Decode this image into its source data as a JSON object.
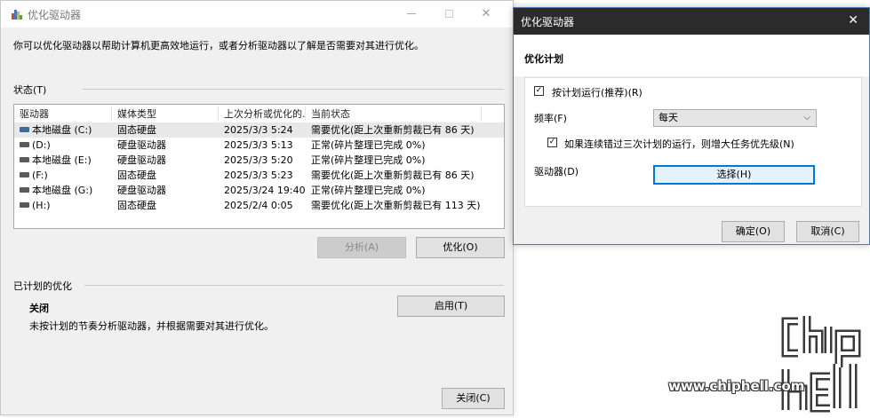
{
  "main_window": {
    "title": "优化驱动器",
    "description": "你可以优化驱动器以帮助计算机更高效地运行，或者分析驱动器以了解是否需要对其进行优化。",
    "status_label": "状态(T)",
    "columns": [
      "驱动器",
      "媒体类型",
      "上次分析或优化的...",
      "当前状态"
    ],
    "drives": [
      {
        "name": "本地磁盘 (C:)",
        "type": "固态硬盘",
        "last": "2025/3/3 5:24",
        "status": "需要优化(距上次重新剪裁已有 86 天)",
        "icon": "system-drive-icon"
      },
      {
        "name": "(D:)",
        "type": "硬盘驱动器",
        "last": "2025/3/3 5:13",
        "status": "正常(碎片整理已完成 0%)",
        "icon": "drive-icon"
      },
      {
        "name": "本地磁盘 (E:)",
        "type": "硬盘驱动器",
        "last": "2025/3/3 5:20",
        "status": "正常(碎片整理已完成 0%)",
        "icon": "drive-icon"
      },
      {
        "name": "(F:)",
        "type": "固态硬盘",
        "last": "2025/3/3 5:23",
        "status": "需要优化(距上次重新剪裁已有 86 天)",
        "icon": "drive-icon"
      },
      {
        "name": "本地磁盘 (G:)",
        "type": "硬盘驱动器",
        "last": "2025/3/24 19:40",
        "status": "正常(碎片整理已完成 0%)",
        "icon": "drive-icon"
      },
      {
        "name": "(H:)",
        "type": "固态硬盘",
        "last": "2025/2/4 0:05",
        "status": "需要优化(距上次重新剪裁已有 113 天)",
        "icon": "drive-icon"
      }
    ],
    "analyze_label": "分析(A)",
    "optimize_label": "优化(O)",
    "scheduled_label": "已计划的优化",
    "scheduled_status": "关闭",
    "scheduled_desc": "未按计划的节奏分析驱动器，并根据需要对其进行优化。",
    "enable_label": "启用(T)",
    "close_label": "关闭(C)"
  },
  "dialog": {
    "title": "优化驱动器",
    "close_glyph": "✕",
    "heading": "优化计划",
    "run_on_schedule_label": "按计划运行(推荐)(R)",
    "run_on_schedule_checked": true,
    "frequency_label": "频率(F)",
    "frequency_value": "每天",
    "increase_priority_label": "如果连续错过三次计划的运行，则增大任务优先级(N)",
    "increase_priority_checked": true,
    "drives_label": "驱动器(D)",
    "choose_label": "选择(H)",
    "ok_label": "确定(O)",
    "cancel_label": "取消(C)"
  },
  "watermark": {
    "text": "www.chiphell.com"
  },
  "colors": {
    "window_bg": "#f0f0f0",
    "dialog_titlebar": "#2b2b2b",
    "accent": "#0078d7"
  }
}
